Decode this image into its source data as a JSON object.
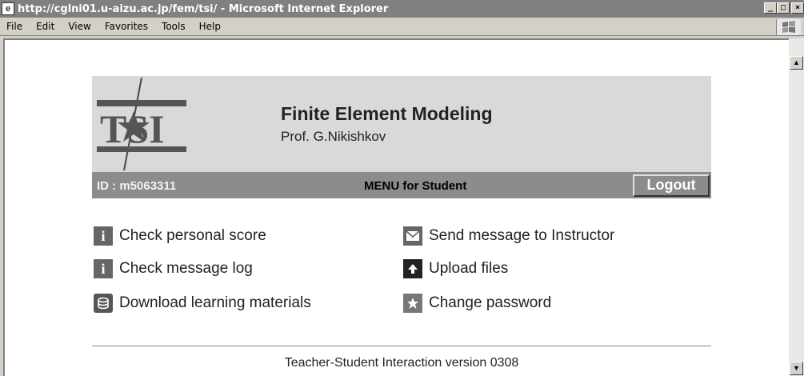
{
  "window": {
    "title": "http://cglni01.u-aizu.ac.jp/fem/tsi/ - Microsoft Internet Explorer",
    "minimize_glyph": "_",
    "maximize_glyph": "□",
    "close_glyph": "×"
  },
  "menubar": {
    "items": [
      {
        "label": "File"
      },
      {
        "label": "Edit"
      },
      {
        "label": "View"
      },
      {
        "label": "Favorites"
      },
      {
        "label": "Tools"
      },
      {
        "label": "Help"
      }
    ]
  },
  "header": {
    "logo_text": "TSI",
    "title": "Finite Element Modeling",
    "subtitle": "Prof. G.Nikishkov"
  },
  "bar": {
    "user_id": "ID : m5063311",
    "menu_title": "MENU for Student",
    "logout_label": "Logout"
  },
  "actions": {
    "left": [
      {
        "label": "Check personal score",
        "icon": "info-icon"
      },
      {
        "label": "Check message log",
        "icon": "info-icon"
      },
      {
        "label": "Download learning materials",
        "icon": "database-icon"
      }
    ],
    "right": [
      {
        "label": "Send message to Instructor",
        "icon": "envelope-icon"
      },
      {
        "label": "Upload files",
        "icon": "upload-arrow-icon"
      },
      {
        "label": "Change password",
        "icon": "star-icon"
      }
    ]
  },
  "footer": {
    "text": "Teacher-Student Interaction version 0308"
  },
  "colors": {
    "header_bg": "#d9d9d9",
    "bar_bg": "#8c8c8c"
  }
}
